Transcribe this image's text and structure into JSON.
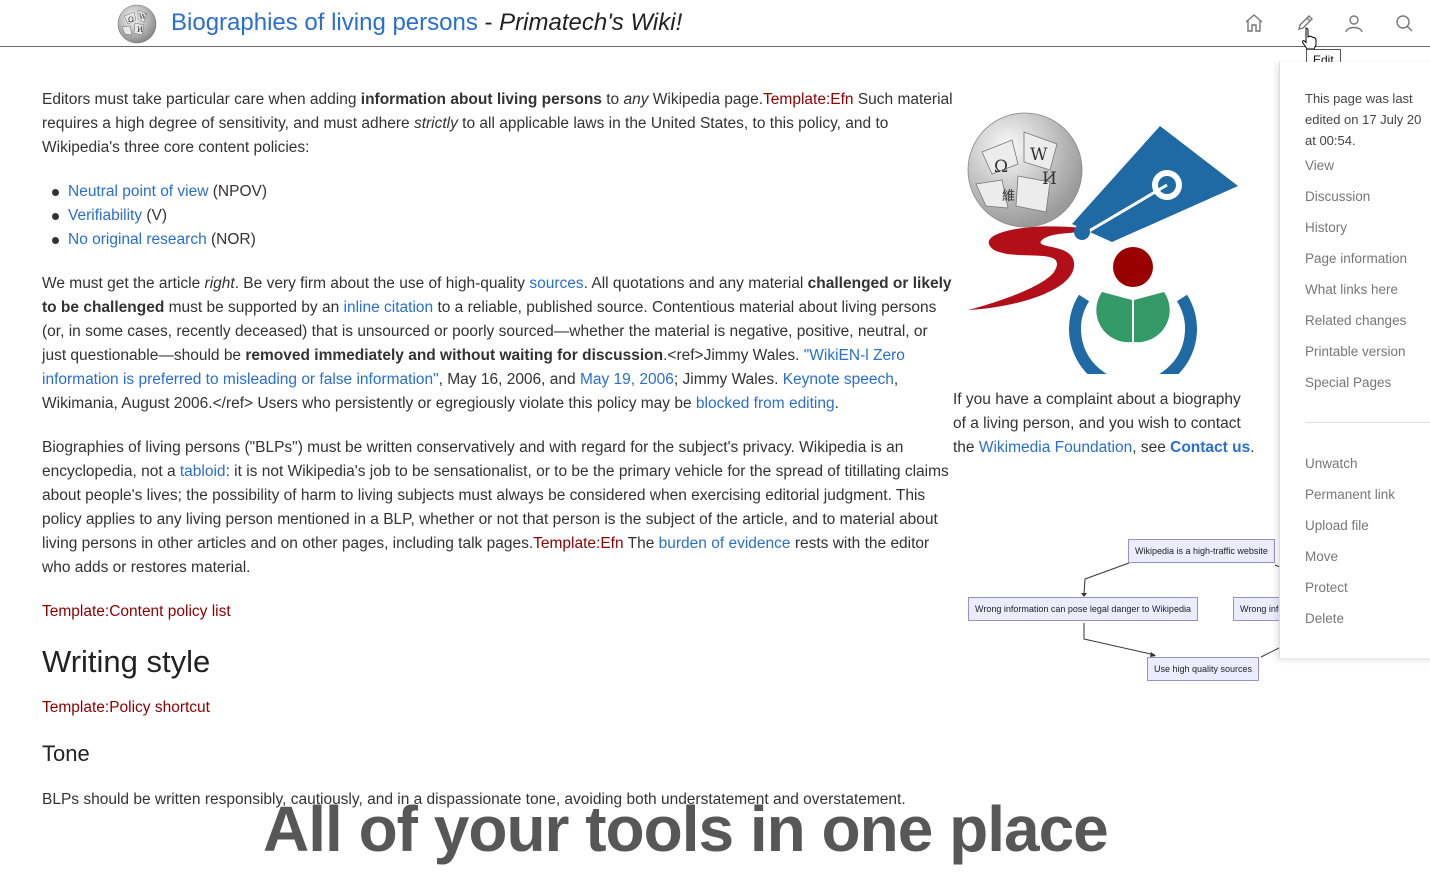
{
  "header": {
    "page_title": "Biographies of living persons",
    "separator": " - ",
    "site_name": "Primatech's Wiki!",
    "tooltip": "Edit"
  },
  "content": {
    "intro": {
      "t1": "Editors must take particular care when adding ",
      "b1": "information about living persons",
      "t2": " to ",
      "i1": "any",
      "t3": " Wikipedia page.",
      "tpl": "Template:Efn",
      "t4": " Such material requires a high degree of sensitivity, and must adhere ",
      "i2": "strictly",
      "t5": " to all applicable laws in the United States, to this policy, and to Wikipedia's three core content policies:"
    },
    "policies": [
      {
        "link": "Neutral point of view",
        "abbr": " (NPOV)"
      },
      {
        "link": "Verifiability",
        "abbr": " (V)"
      },
      {
        "link": "No original research",
        "abbr": " (NOR)"
      }
    ],
    "p2": {
      "t1": "We must get the article ",
      "i1": "right",
      "t2": ". Be very firm about the use of high-quality ",
      "l1": "sources",
      "t3": ". All quotations and any material ",
      "b1": "challenged or likely to be challenged",
      "t4": " must be supported by an ",
      "l2": "inline citation",
      "t5": " to a reliable, published source. Contentious material about living persons (or, in some cases, recently deceased) that is unsourced or poorly sourced—whether the material is negative, positive, neutral, or just questionable—should be ",
      "b2": "removed immediately and without waiting for discussion",
      "t6": ".<ref>Jimmy Wales. ",
      "l3": "\"WikiEN-l Zero information is preferred to misleading or false information\"",
      "t7": ", May 16, 2006, and ",
      "l4": "May 19, 2006",
      "t8": "; Jimmy Wales. ",
      "l5": "Keynote speech",
      "t9": ", Wikimania, August 2006.</ref> Users who persistently or egregiously violate this policy may be ",
      "l6": "blocked from editing",
      "t10": "."
    },
    "p3": {
      "t1": "Biographies of living persons (\"BLPs\") must be written conservatively and with regard for the subject's privacy. Wikipedia is an encyclopedia, not a ",
      "l1": "tabloid",
      "t2": ": it is not Wikipedia's job to be sensationalist, or to be the primary vehicle for the spread of titillating claims about people's lives; the possibility of harm to living subjects must always be considered when exercising editorial judgment. This policy applies to any living person mentioned in a BLP, whether or not that person is the subject of the article, and to material about living persons in other articles and on other pages, including talk pages.",
      "tpl": "Template:Efn",
      "t3": " The ",
      "l2": "burden of evidence",
      "t4": " rests with the editor who adds or restores material."
    },
    "content_policy_tpl": "Template:Content policy list",
    "h_writing": "Writing style",
    "policy_shortcut_tpl": "Template:Policy shortcut",
    "h_tone": "Tone",
    "tone_text": "BLPs should be written responsibly, cautiously, and in a dispassionate tone, avoiding both understatement and overstatement."
  },
  "side": {
    "t1": "If you have a complaint about a biography of a living person, and you wish to contact the ",
    "l1": "Wikimedia Foundation",
    "t2": ", see ",
    "l2": "Contact us",
    "t3": "."
  },
  "flowchart": {
    "n1": "Wikipedia is a high-traffic website",
    "n2": "Wrong information can pose legal danger to Wikipedia",
    "n3": "Wrong infor",
    "n4": "Use high quality sources"
  },
  "banner": "All of your tools in one place",
  "panel": {
    "last_edited": "This page was last\nedited on 17 July 20\nat 00:54.",
    "items_a": [
      "View",
      "Discussion",
      "History",
      "Page information",
      "What links here",
      "Related changes",
      "Printable version",
      "Special Pages"
    ],
    "items_b": [
      "Unwatch",
      "Permanent link",
      "Upload file",
      "Move",
      "Protect",
      "Delete"
    ]
  },
  "icons": [
    "home-icon",
    "edit-icon",
    "user-icon",
    "search-icon"
  ],
  "colors": {
    "link": "#2a6ed0",
    "template_red": "#8b0000",
    "wikimedia_blue": "#1f6aa5",
    "wikimedia_red": "#a10d0d",
    "wikimedia_green": "#339966"
  }
}
